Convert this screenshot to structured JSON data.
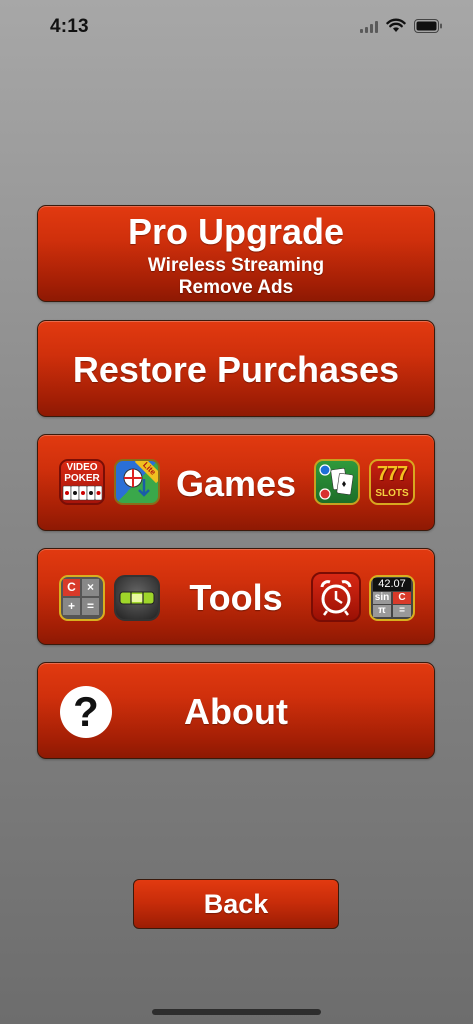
{
  "status_bar": {
    "time": "4:13"
  },
  "menu": {
    "pro_upgrade": {
      "title": "Pro Upgrade",
      "line1": "Wireless Streaming",
      "line2": "Remove Ads"
    },
    "restore": {
      "title": "Restore Purchases"
    },
    "games": {
      "title": "Games",
      "video_poker_icon": {
        "line1": "VIDEO",
        "line2": "POKER"
      },
      "level_lite_icon": {
        "badge": "Lite"
      },
      "slots_icon": {
        "digits": "777",
        "label": "SLOTS"
      }
    },
    "tools": {
      "title": "Tools",
      "calculator_icon": {
        "keys": [
          "C",
          "×",
          "+",
          "="
        ]
      },
      "sci_calc_icon": {
        "display": "42.07",
        "keys": [
          "sin",
          "C",
          "π",
          "="
        ]
      }
    },
    "about": {
      "title": "About",
      "help_glyph": "?"
    }
  },
  "back_button": {
    "label": "Back"
  },
  "colors": {
    "button_red": "#d0300c",
    "button_dark": "#8e1903",
    "background_top": "#a7a7a7",
    "background_bottom": "#6d6d6d"
  }
}
